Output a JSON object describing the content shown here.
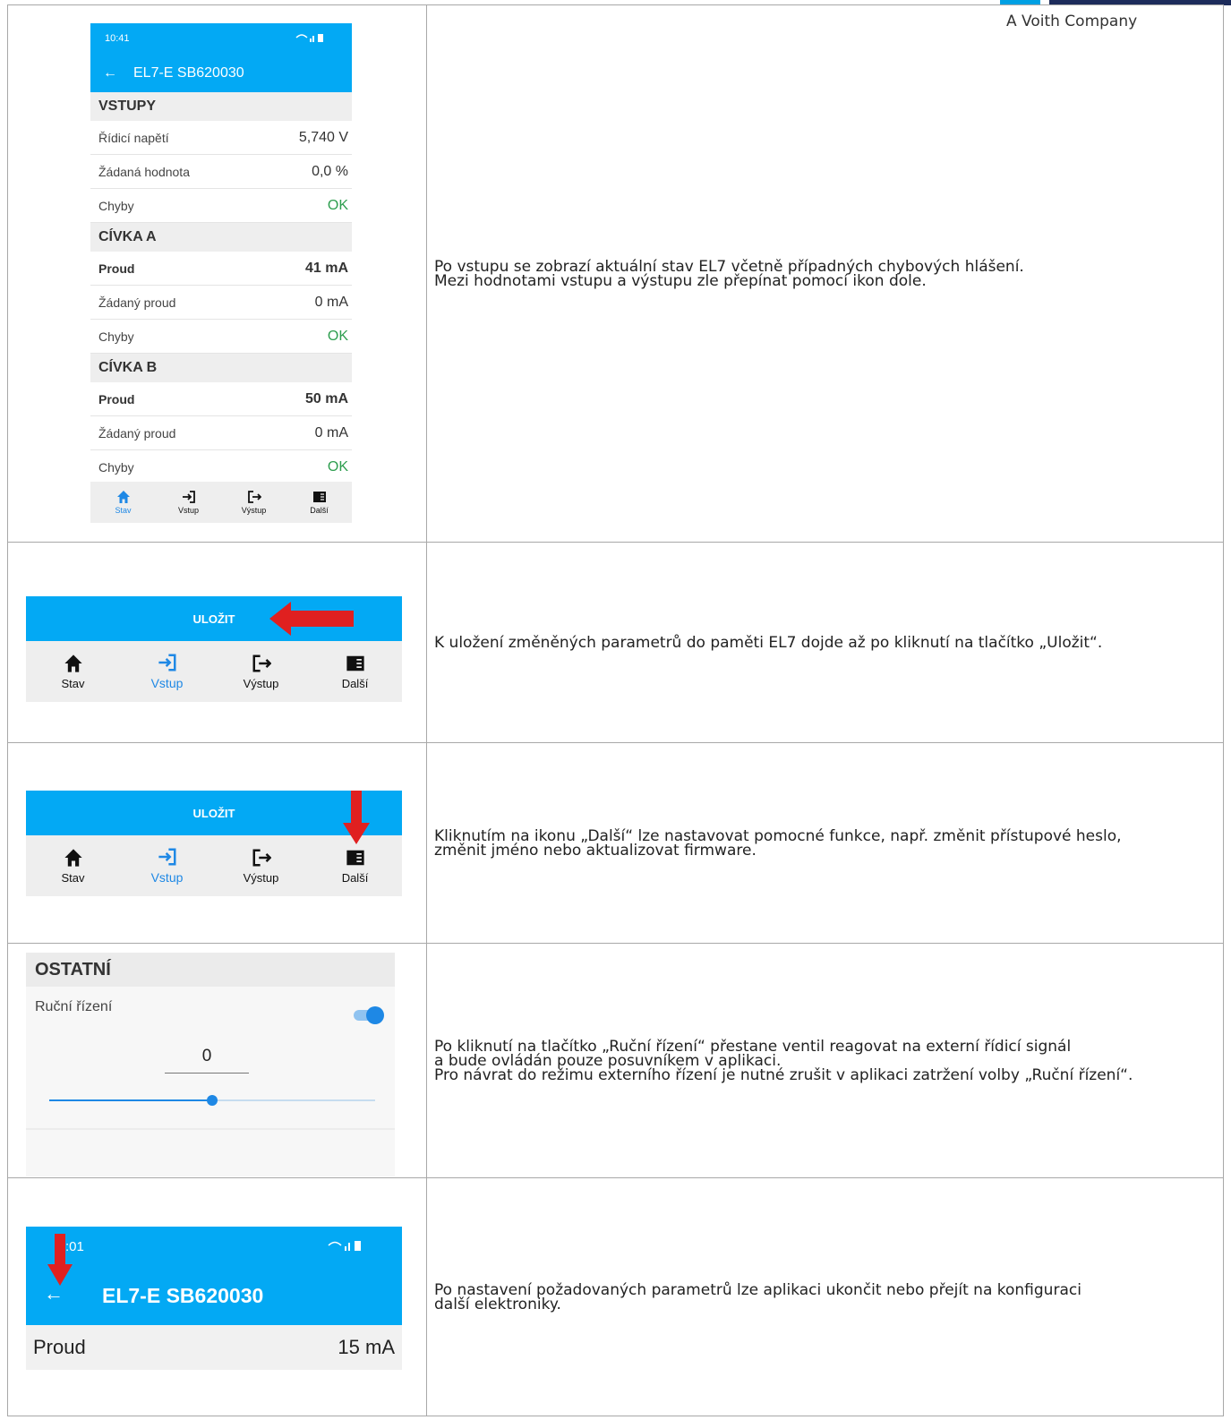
{
  "brand": {
    "tagline": "A Voith Company",
    "colors": {
      "blue": "#00a0e3",
      "navy": "#1d2c5b"
    }
  },
  "colors": {
    "app_blue": "#03a9f4",
    "ok_green": "#2e9e4f",
    "active_blue": "#1e88e5",
    "arrow_red": "#e02020"
  },
  "row1": {
    "phone": {
      "time": "10:41",
      "status_icons": "wifi-signal-battery",
      "title": "EL7-E SB620030",
      "sections": [
        {
          "heading": "VSTUPY",
          "rows": [
            {
              "label": "Řídicí napětí",
              "value": "5,740 V"
            },
            {
              "label": "Žádaná hodnota",
              "value": "0,0 %"
            },
            {
              "label": "Chyby",
              "value": "OK"
            }
          ]
        },
        {
          "heading": "CÍVKA A",
          "rows": [
            {
              "label": "Proud",
              "value": "41 mA"
            },
            {
              "label": "Žádaný proud",
              "value": "0 mA"
            },
            {
              "label": "Chyby",
              "value": "OK"
            }
          ]
        },
        {
          "heading": "CÍVKA B",
          "rows": [
            {
              "label": "Proud",
              "value": "50 mA"
            },
            {
              "label": "Žádaný proud",
              "value": "0 mA"
            },
            {
              "label": "Chyby",
              "value": "OK"
            }
          ]
        }
      ],
      "nav": [
        "Stav",
        "Vstup",
        "Výstup",
        "Další"
      ],
      "active_nav": "Stav"
    },
    "text": [
      "Po vstupu se zobrazí aktuální stav EL7 včetně případných chybových hlášení.",
      "Mezi hodnotami vstupu a výstupu zle přepínat pomocí ikon dole."
    ]
  },
  "row2": {
    "save_label": "ULOŽIT",
    "nav": [
      "Stav",
      "Vstup",
      "Výstup",
      "Další"
    ],
    "active_nav": "Vstup",
    "text": [
      "K uložení změněných parametrů do paměti EL7 dojde až po kliknutí na tlačítko „Uložit“."
    ]
  },
  "row3": {
    "save_label": "ULOŽIT",
    "nav": [
      "Stav",
      "Vstup",
      "Výstup",
      "Další"
    ],
    "active_nav": "Vstup",
    "text": [
      "Kliknutím na ikonu „Další“ lze nastavovat pomocné funkce, např. změnit přístupové heslo,",
      "změnit jméno nebo aktualizovat firmware."
    ]
  },
  "row4": {
    "heading": "OSTATNÍ",
    "toggle_label": "Ruční řízení",
    "toggle_on": true,
    "input_value": "0",
    "slider_fraction": 0.5,
    "text": [
      "Po kliknutí na tlačítko „Ruční řízení“ přestane ventil reagovat na externí řídicí signál",
      "a bude ovládán pouze posuvníkem v aplikaci.",
      "Pro návrat do režimu externího řízení je nutné zrušit v aplikaci zatržení volby „Ruční řízení“."
    ]
  },
  "row5": {
    "time": ":01",
    "title": "EL7-E SB620030",
    "row_label": "Proud",
    "row_value": "15 mA",
    "text": [
      "Po nastavení požadovaných parametrů lze aplikaci ukončit nebo přejít na konfiguraci",
      "další elektroniky."
    ]
  }
}
